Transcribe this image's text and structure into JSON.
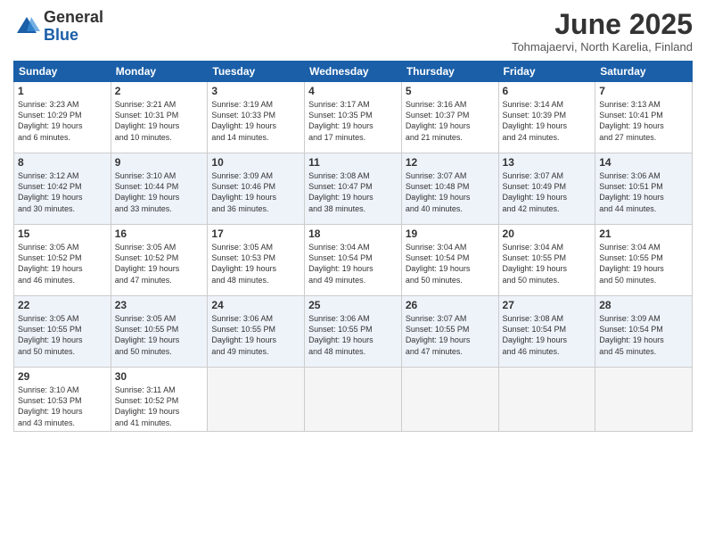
{
  "logo": {
    "general": "General",
    "blue": "Blue"
  },
  "title": "June 2025",
  "subtitle": "Tohmajaervi, North Karelia, Finland",
  "headers": [
    "Sunday",
    "Monday",
    "Tuesday",
    "Wednesday",
    "Thursday",
    "Friday",
    "Saturday"
  ],
  "weeks": [
    [
      {
        "day": "1",
        "sunrise": "3:23 AM",
        "sunset": "10:29 PM",
        "daylight": "19 hours and 6 minutes."
      },
      {
        "day": "2",
        "sunrise": "3:21 AM",
        "sunset": "10:31 PM",
        "daylight": "19 hours and 10 minutes."
      },
      {
        "day": "3",
        "sunrise": "3:19 AM",
        "sunset": "10:33 PM",
        "daylight": "19 hours and 14 minutes."
      },
      {
        "day": "4",
        "sunrise": "3:17 AM",
        "sunset": "10:35 PM",
        "daylight": "19 hours and 17 minutes."
      },
      {
        "day": "5",
        "sunrise": "3:16 AM",
        "sunset": "10:37 PM",
        "daylight": "19 hours and 21 minutes."
      },
      {
        "day": "6",
        "sunrise": "3:14 AM",
        "sunset": "10:39 PM",
        "daylight": "19 hours and 24 minutes."
      },
      {
        "day": "7",
        "sunrise": "3:13 AM",
        "sunset": "10:41 PM",
        "daylight": "19 hours and 27 minutes."
      }
    ],
    [
      {
        "day": "8",
        "sunrise": "3:12 AM",
        "sunset": "10:42 PM",
        "daylight": "19 hours and 30 minutes."
      },
      {
        "day": "9",
        "sunrise": "3:10 AM",
        "sunset": "10:44 PM",
        "daylight": "19 hours and 33 minutes."
      },
      {
        "day": "10",
        "sunrise": "3:09 AM",
        "sunset": "10:46 PM",
        "daylight": "19 hours and 36 minutes."
      },
      {
        "day": "11",
        "sunrise": "3:08 AM",
        "sunset": "10:47 PM",
        "daylight": "19 hours and 38 minutes."
      },
      {
        "day": "12",
        "sunrise": "3:07 AM",
        "sunset": "10:48 PM",
        "daylight": "19 hours and 40 minutes."
      },
      {
        "day": "13",
        "sunrise": "3:07 AM",
        "sunset": "10:49 PM",
        "daylight": "19 hours and 42 minutes."
      },
      {
        "day": "14",
        "sunrise": "3:06 AM",
        "sunset": "10:51 PM",
        "daylight": "19 hours and 44 minutes."
      }
    ],
    [
      {
        "day": "15",
        "sunrise": "3:05 AM",
        "sunset": "10:52 PM",
        "daylight": "19 hours and 46 minutes."
      },
      {
        "day": "16",
        "sunrise": "3:05 AM",
        "sunset": "10:52 PM",
        "daylight": "19 hours and 47 minutes."
      },
      {
        "day": "17",
        "sunrise": "3:05 AM",
        "sunset": "10:53 PM",
        "daylight": "19 hours and 48 minutes."
      },
      {
        "day": "18",
        "sunrise": "3:04 AM",
        "sunset": "10:54 PM",
        "daylight": "19 hours and 49 minutes."
      },
      {
        "day": "19",
        "sunrise": "3:04 AM",
        "sunset": "10:54 PM",
        "daylight": "19 hours and 50 minutes."
      },
      {
        "day": "20",
        "sunrise": "3:04 AM",
        "sunset": "10:55 PM",
        "daylight": "19 hours and 50 minutes."
      },
      {
        "day": "21",
        "sunrise": "3:04 AM",
        "sunset": "10:55 PM",
        "daylight": "19 hours and 50 minutes."
      }
    ],
    [
      {
        "day": "22",
        "sunrise": "3:05 AM",
        "sunset": "10:55 PM",
        "daylight": "19 hours and 50 minutes."
      },
      {
        "day": "23",
        "sunrise": "3:05 AM",
        "sunset": "10:55 PM",
        "daylight": "19 hours and 50 minutes."
      },
      {
        "day": "24",
        "sunrise": "3:06 AM",
        "sunset": "10:55 PM",
        "daylight": "19 hours and 49 minutes."
      },
      {
        "day": "25",
        "sunrise": "3:06 AM",
        "sunset": "10:55 PM",
        "daylight": "19 hours and 48 minutes."
      },
      {
        "day": "26",
        "sunrise": "3:07 AM",
        "sunset": "10:55 PM",
        "daylight": "19 hours and 47 minutes."
      },
      {
        "day": "27",
        "sunrise": "3:08 AM",
        "sunset": "10:54 PM",
        "daylight": "19 hours and 46 minutes."
      },
      {
        "day": "28",
        "sunrise": "3:09 AM",
        "sunset": "10:54 PM",
        "daylight": "19 hours and 45 minutes."
      }
    ],
    [
      {
        "day": "29",
        "sunrise": "3:10 AM",
        "sunset": "10:53 PM",
        "daylight": "19 hours and 43 minutes."
      },
      {
        "day": "30",
        "sunrise": "3:11 AM",
        "sunset": "10:52 PM",
        "daylight": "19 hours and 41 minutes."
      },
      null,
      null,
      null,
      null,
      null
    ]
  ]
}
